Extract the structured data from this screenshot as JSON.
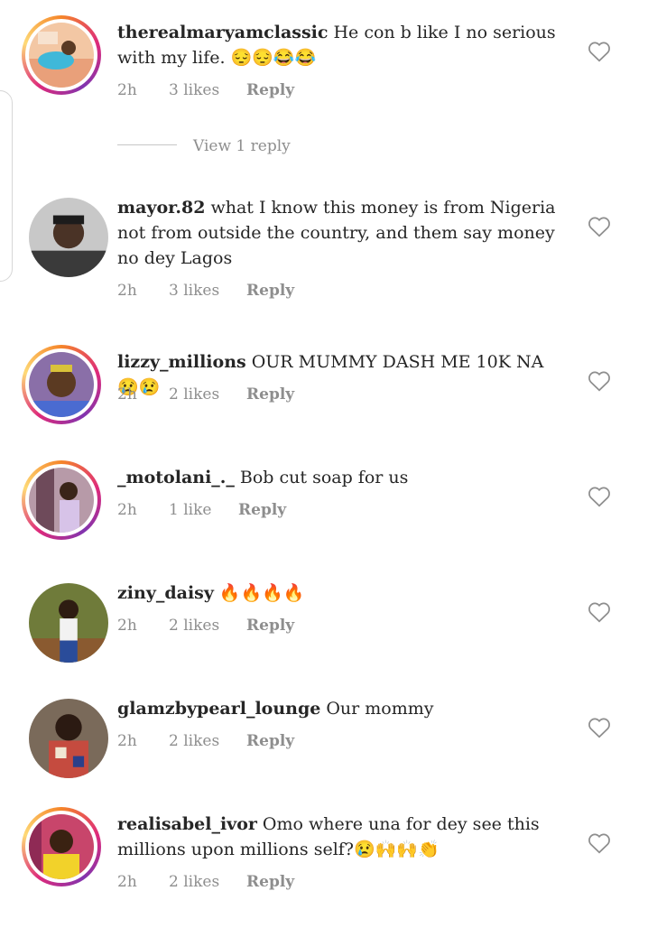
{
  "comments": [
    {
      "username": "therealmaryamclassic",
      "text": "He con b like I no serious with my life. 😔😔😂😂",
      "time": "2h",
      "likes": "3 likes",
      "reply": "Reply",
      "story_ring": true
    },
    {
      "username": "mayor.82",
      "text": "what I know this money is from Nigeria not from outside the country, and them say money no dey Lagos",
      "time": "2h",
      "likes": "3 likes",
      "reply": "Reply",
      "story_ring": false
    },
    {
      "username": "lizzy_millions",
      "text": "OUR MUMMY DASH ME 10K NA 😢😢",
      "time": "2h",
      "likes": "2 likes",
      "reply": "Reply",
      "story_ring": true
    },
    {
      "username": "_motolani_._",
      "text": "Bob cut soap for us",
      "time": "2h",
      "likes": "1 like",
      "reply": "Reply",
      "story_ring": true
    },
    {
      "username": "ziny_daisy",
      "text": "🔥🔥🔥🔥",
      "time": "2h",
      "likes": "2 likes",
      "reply": "Reply",
      "story_ring": false
    },
    {
      "username": "glamzbypearl_lounge",
      "text": "Our mommy",
      "time": "2h",
      "likes": "2 likes",
      "reply": "Reply",
      "story_ring": false
    },
    {
      "username": "realisabel_ivor",
      "text": "Omo where una for dey see this millions upon millions self?😢🙌🙌👏",
      "time": "2h",
      "likes": "2 likes",
      "reply": "Reply",
      "story_ring": true
    }
  ],
  "view_replies": "View 1 reply",
  "icons": {
    "like": "heart-outline-icon"
  },
  "colors": {
    "text": "#262626",
    "meta": "#8e8e8e",
    "ring_start": "#f58529",
    "ring_mid": "#dd2a7b",
    "ring_end": "#8134af"
  }
}
